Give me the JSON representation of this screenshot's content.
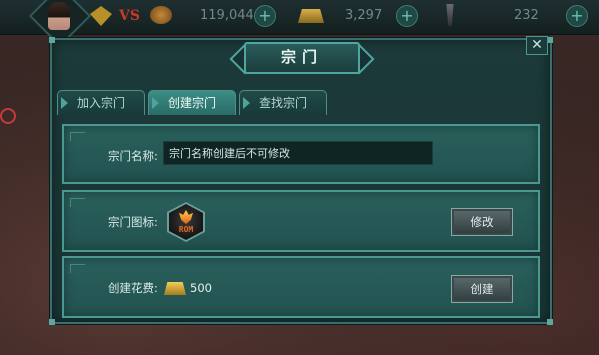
{
  "hud": {
    "vs_label": "VS",
    "coins": "119,044",
    "gold": "3,297",
    "energy": "232",
    "plus_symbol": "+"
  },
  "dialog": {
    "title": "宗门",
    "close_symbol": "✕"
  },
  "tabs": [
    {
      "label": "加入宗门",
      "active": false
    },
    {
      "label": "创建宗门",
      "active": true
    },
    {
      "label": "查找宗门",
      "active": false
    }
  ],
  "form": {
    "name_label": "宗门名称:",
    "name_value": "宗门名称创建后不可修改",
    "icon_label": "宗门图标:",
    "icon_text": "ROM",
    "modify_button": "修改",
    "cost_label": "创建花费:",
    "cost_value": "500",
    "create_button": "创建"
  },
  "icons": {
    "gem": "diamond-icon",
    "medal": "medal-icon",
    "gold": "gold-ingot-icon",
    "energy": "torch-icon"
  },
  "colors": {
    "panel": "#2a605c",
    "border": "#4a9890",
    "active_tab": "#3c8d86"
  }
}
